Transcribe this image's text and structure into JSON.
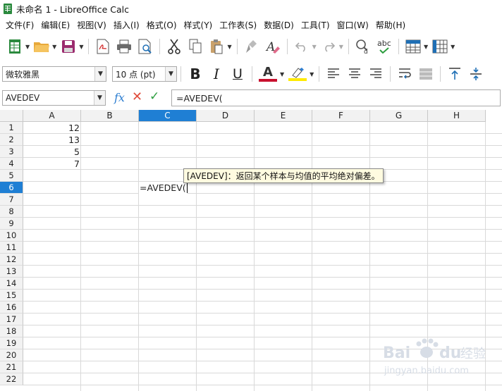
{
  "window": {
    "title": "未命名 1 - LibreOffice Calc"
  },
  "menu": [
    "文件(F)",
    "编辑(E)",
    "视图(V)",
    "插入(I)",
    "格式(O)",
    "样式(Y)",
    "工作表(S)",
    "数据(D)",
    "工具(T)",
    "窗口(W)",
    "帮助(H)"
  ],
  "toolbar": {
    "font_name": "微软雅黑",
    "font_size": "10 点 (pt)",
    "bold": "B",
    "italic": "I",
    "underline": "U",
    "font_color_glyph": "A",
    "spell_label": "abc"
  },
  "colors": {
    "accent_blue": "#1f7fd4",
    "font_color_bar": "#c8102e",
    "highlight_bar": "#ffea00",
    "cancel_red": "#e04b3a",
    "accept_green": "#2e9e40"
  },
  "formula_bar": {
    "name_box": "AVEDEV",
    "fx_label": "fx",
    "cancel": "✕",
    "accept": "✓",
    "input": "=AVEDEV("
  },
  "grid": {
    "columns": [
      "A",
      "B",
      "C",
      "D",
      "E",
      "F",
      "G",
      "H"
    ],
    "active_column": "C",
    "rows": [
      "1",
      "2",
      "3",
      "4",
      "5",
      "6",
      "7",
      "8",
      "9",
      "10",
      "11",
      "12",
      "13",
      "14",
      "15",
      "16",
      "17",
      "18",
      "19",
      "20",
      "21",
      "22"
    ],
    "active_row": "6",
    "values": {
      "A1": "12",
      "A2": "13",
      "A3": "5",
      "A4": "7"
    },
    "editing_cell": {
      "ref": "C6",
      "text": "=AVEDEV("
    }
  },
  "tooltip": "[AVEDEV]：返回某个样本与均值的平均绝对偏差。",
  "watermark": {
    "brand": "Bai",
    "brand_paw": "du",
    "suffix": "经验",
    "url": "jingyan.baidu.com"
  }
}
